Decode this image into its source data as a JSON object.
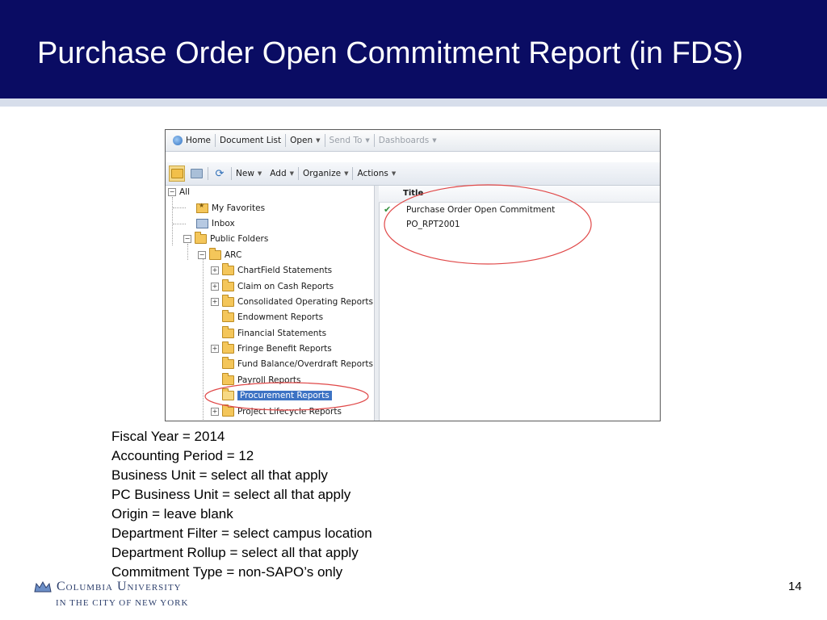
{
  "slide": {
    "title": "Purchase Order Open Commitment Report (in FDS)",
    "page_number": "14",
    "logo_name": "Columbia University",
    "logo_sub": "IN THE CITY OF NEW YORK"
  },
  "colors": {
    "header_bg": "#0a0c63",
    "header_rule": "#d7deeb",
    "highlight": "#3d73c4",
    "annotation": "#e04848"
  },
  "app": {
    "nav": {
      "home": "Home",
      "document_list": "Document List",
      "open": "Open",
      "send_to": "Send To",
      "dashboards": "Dashboards"
    },
    "toolbar": {
      "new": "New",
      "add": "Add",
      "organize": "Organize",
      "actions": "Actions"
    },
    "tree": {
      "root": "All",
      "my_favorites": "My Favorites",
      "inbox": "Inbox",
      "public_folders": "Public Folders",
      "arc": "ARC",
      "folders": [
        "ChartField Statements",
        "Claim on Cash Reports",
        "Consolidated Operating Reports (",
        "Endowment Reports",
        "Financial Statements",
        "Fringe Benefit Reports",
        "Fund Balance/Overdraft Reports",
        "Payroll Reports",
        "Procurement Reports",
        "Project Lifecycle Reports"
      ],
      "selected": "Procurement Reports"
    },
    "list": {
      "column_title": "Title",
      "items": [
        "Purchase Order Open Commitment",
        "PO_RPT2001"
      ]
    }
  },
  "parameters": [
    "Fiscal Year = 2014",
    "Accounting Period = 12",
    "Business Unit = select all that apply",
    "PC Business Unit = select all that apply",
    "Origin = leave blank",
    "Department Filter = select campus location",
    "Department Rollup = select all that apply",
    "Commitment Type = non-SAPO’s only"
  ]
}
